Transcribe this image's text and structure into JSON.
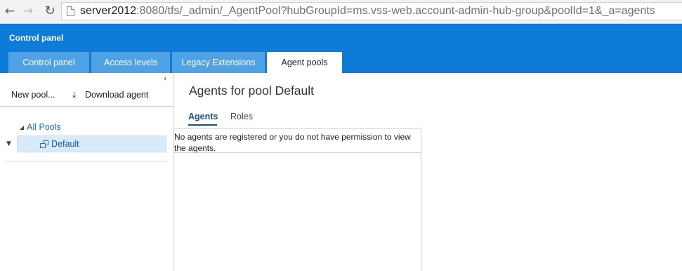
{
  "browser": {
    "back_glyph": "←",
    "forward_glyph": "→",
    "reload_glyph": "↻",
    "url_host": "server2012",
    "url_rest": ":8080/tfs/_admin/_AgentPool?hubGroupId=ms.vss-web.account-admin-hub-group&poolId=1&_a=agents"
  },
  "header": {
    "title": "Control panel",
    "accent_color": "#0d7bd7",
    "tabs": [
      {
        "label": "Control panel",
        "active": false
      },
      {
        "label": "Access levels",
        "active": false
      },
      {
        "label": "Legacy Extensions",
        "active": false
      },
      {
        "label": "Agent pools",
        "active": true
      }
    ]
  },
  "left_panel": {
    "collapse_glyph": "‹",
    "new_pool_label": "New pool...",
    "download_icon": "download-icon",
    "download_glyph": "⤓",
    "download_label": "Download agent",
    "tree": {
      "root_label": "All Pools",
      "root_expander": "◢",
      "row_arrow": "▼",
      "selected_item": "Default",
      "item_icon": "agent-pool-icon"
    }
  },
  "main": {
    "title": "Agents for pool Default",
    "subtabs": [
      {
        "label": "Agents",
        "active": true
      },
      {
        "label": "Roles",
        "active": false
      }
    ],
    "empty_message": "No agents are registered or you do not have permission to view the agents."
  }
}
